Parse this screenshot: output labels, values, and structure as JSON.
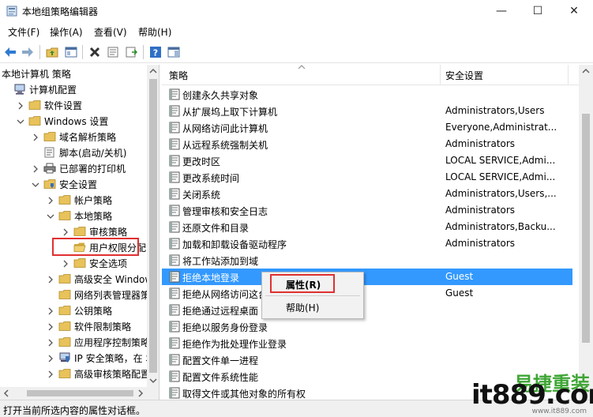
{
  "window": {
    "title": "本地组策略编辑器",
    "minimize_glyph": "—",
    "maximize_glyph": "☐",
    "close_glyph": "✕"
  },
  "menu": {
    "items": [
      "文件(F)",
      "操作(A)",
      "查看(V)",
      "帮助(H)"
    ]
  },
  "toolbar": {
    "icons": [
      "back-arrow-icon",
      "forward-arrow-icon",
      "up-folder-icon",
      "show-hide-tree-icon",
      "delete-icon",
      "properties-icon",
      "export-list-icon",
      "help-icon",
      "action-pane-icon"
    ]
  },
  "tree": {
    "root_label": "本地计算机 策略",
    "items": [
      {
        "label": "计算机配置",
        "level": 0,
        "chevron": "none",
        "icon": "computer-icon"
      },
      {
        "label": "软件设置",
        "level": 1,
        "chevron": "right",
        "icon": "folder-icon"
      },
      {
        "label": "Windows 设置",
        "level": 1,
        "chevron": "down",
        "icon": "folder-icon"
      },
      {
        "label": "域名解析策略",
        "level": 2,
        "chevron": "right",
        "icon": "folder-icon"
      },
      {
        "label": "脚本(启动/关机)",
        "level": 2,
        "chevron": "none",
        "icon": "script-icon"
      },
      {
        "label": "已部署的打印机",
        "level": 2,
        "chevron": "right",
        "icon": "printer-icon"
      },
      {
        "label": "安全设置",
        "level": 2,
        "chevron": "down",
        "icon": "security-folder-icon"
      },
      {
        "label": "帐户策略",
        "level": 3,
        "chevron": "right",
        "icon": "folder-icon"
      },
      {
        "label": "本地策略",
        "level": 3,
        "chevron": "down",
        "icon": "folder-icon"
      },
      {
        "label": "审核策略",
        "level": 4,
        "chevron": "right",
        "icon": "folder-icon"
      },
      {
        "label": "用户权限分配",
        "level": 4,
        "chevron": "none",
        "icon": "folder-open-icon",
        "selected": true
      },
      {
        "label": "安全选项",
        "level": 4,
        "chevron": "right",
        "icon": "folder-icon"
      },
      {
        "label": "高级安全 Windows",
        "level": 3,
        "chevron": "right",
        "icon": "folder-icon"
      },
      {
        "label": "网络列表管理器策略",
        "level": 3,
        "chevron": "none",
        "icon": "folder-icon"
      },
      {
        "label": "公钥策略",
        "level": 3,
        "chevron": "right",
        "icon": "folder-icon"
      },
      {
        "label": "软件限制策略",
        "level": 3,
        "chevron": "right",
        "icon": "folder-icon"
      },
      {
        "label": "应用程序控制策略",
        "level": 3,
        "chevron": "right",
        "icon": "folder-icon"
      },
      {
        "label": "IP 安全策略，在 本地",
        "level": 3,
        "chevron": "right",
        "icon": "ip-security-icon"
      },
      {
        "label": "高级审核策略配置",
        "level": 3,
        "chevron": "right",
        "icon": "folder-icon"
      }
    ]
  },
  "list": {
    "col_policy": "策略",
    "col_setting": "安全设置",
    "rows": [
      {
        "policy": "创建永久共享对象",
        "setting": ""
      },
      {
        "policy": "从扩展坞上取下计算机",
        "setting": "Administrators,Users"
      },
      {
        "policy": "从网络访问此计算机",
        "setting": "Everyone,Administrat..."
      },
      {
        "policy": "从远程系统强制关机",
        "setting": "Administrators"
      },
      {
        "policy": "更改时区",
        "setting": "LOCAL SERVICE,Admi..."
      },
      {
        "policy": "更改系统时间",
        "setting": "LOCAL SERVICE,Admi..."
      },
      {
        "policy": "关闭系统",
        "setting": "Administrators,Users,..."
      },
      {
        "policy": "管理审核和安全日志",
        "setting": "Administrators"
      },
      {
        "policy": "还原文件和目录",
        "setting": "Administrators,Backu..."
      },
      {
        "policy": "加载和卸载设备驱动程序",
        "setting": "Administrators"
      },
      {
        "policy": "将工作站添加到域",
        "setting": ""
      },
      {
        "policy": "拒绝本地登录",
        "setting": "Guest",
        "selected": true
      },
      {
        "policy": "拒绝从网络访问这台",
        "setting": "Guest"
      },
      {
        "policy": "拒绝通过远程桌面",
        "setting": ""
      },
      {
        "policy": "拒绝以服务身份登录",
        "setting": ""
      },
      {
        "policy": "拒绝作为批处理作业登录",
        "setting": ""
      },
      {
        "policy": "配置文件单一进程",
        "setting": ""
      },
      {
        "policy": "配置文件系统性能",
        "setting": ""
      },
      {
        "policy": "取得文件或其他对象的所有权",
        "setting": ""
      }
    ]
  },
  "context_menu": {
    "properties": "属性(R)",
    "help": "帮助(H)"
  },
  "status": {
    "text": "打开当前所选内容的属性对话框。"
  },
  "watermark": {
    "brand": "it889.com",
    "cn": "易捷重装",
    "url": "www.it889.com"
  },
  "colors": {
    "selection": "#3399ff",
    "highlight": "#e03030",
    "folder": "#e8c25a"
  }
}
